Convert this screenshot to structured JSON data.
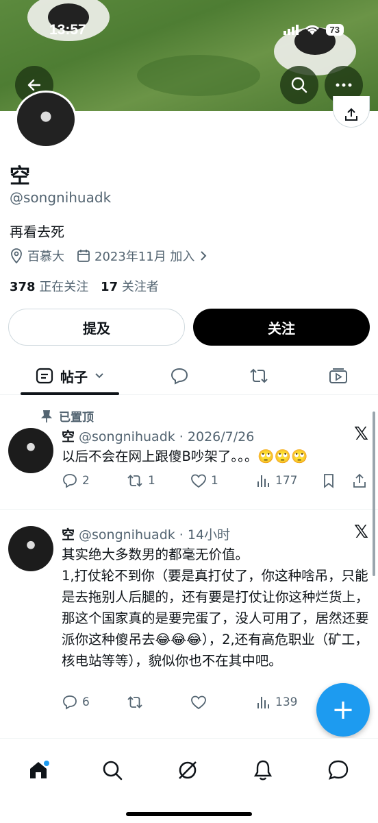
{
  "status_bar": {
    "time": "13:57",
    "battery": "73"
  },
  "profile": {
    "name": "空",
    "handle": "@songnihuadk",
    "bio": "再看去死",
    "location": "百慕大",
    "joined": "2023年11月 加入",
    "following_count": "378",
    "following_label": "正在关注",
    "followers_count": "17",
    "followers_label": "关注者"
  },
  "buttons": {
    "mention": "提及",
    "follow": "关注"
  },
  "tabs": {
    "posts": "帖子"
  },
  "tweets": [
    {
      "pinned_label": "已置顶",
      "name": "空",
      "handle": "@songnihuadk",
      "time": "2026/7/26",
      "text": "以后不会在网上跟傻B吵架了。。。🙄🙄🙄",
      "replies": "2",
      "retweets": "1",
      "likes": "1",
      "views": "177"
    },
    {
      "name": "空",
      "handle": "@songnihuadk",
      "time": "14小时",
      "text": "其实绝大多数男的都毫无价值。\n1,打仗轮不到你（要是真打仗了，你这种啥吊，只能是去拖别人后腿的，还有要是打仗让你这种烂货上，那这个国家真的是要完蛋了，没人可用了，居然还要派你这种傻吊去😂😂😂），2,还有高危职业（矿工，核电站等等），貌似你也不在其中吧。",
      "replies": "6",
      "retweets": "",
      "likes": "",
      "views": "139"
    }
  ],
  "icons": {
    "back": "arrow-left-icon",
    "search": "search-icon",
    "more": "more-icon",
    "share": "share-icon",
    "location": "location-icon",
    "calendar": "calendar-icon",
    "chevron": "chevron-right-icon",
    "x_logo": "𝕏",
    "compose": "+"
  },
  "colors": {
    "accent": "#1d9bf0",
    "text": "#0f1419",
    "muted": "#536471"
  }
}
